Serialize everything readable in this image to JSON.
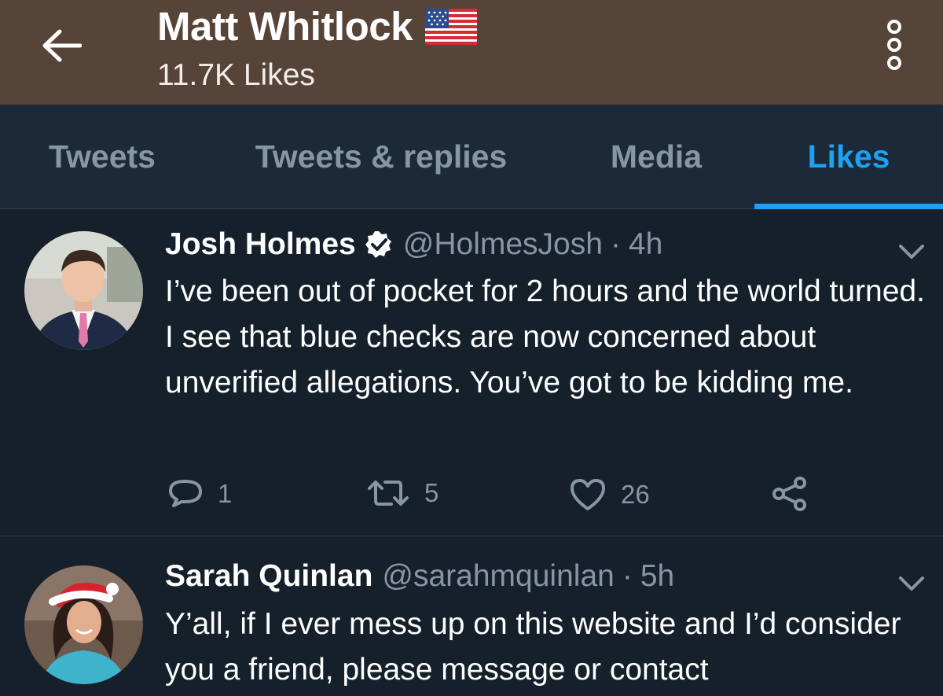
{
  "header": {
    "title": "Matt Whitlock",
    "subtitle": "11.7K Likes",
    "flag_icon": "us-flag-icon",
    "back_icon": "arrow-left-icon",
    "more_icon": "more-vertical-icon"
  },
  "tabs": [
    {
      "label": "Tweets",
      "active": false
    },
    {
      "label": "Tweets & replies",
      "active": false
    },
    {
      "label": "Media",
      "active": false
    },
    {
      "label": "Likes",
      "active": true
    }
  ],
  "tweets": [
    {
      "name": "Josh Holmes",
      "verified": true,
      "handle": "@HolmesJosh",
      "separator": "·",
      "time": "4h",
      "text": "I’ve been out of pocket for 2 hours and the world turned. I see that blue checks are now concerned about unverified allegations. You’ve got to be kidding me.",
      "replies": "1",
      "retweets": "5",
      "likes": "26"
    },
    {
      "name": "Sarah Quinlan",
      "verified": false,
      "handle": "@sarahmquinlan",
      "separator": "·",
      "time": "5h",
      "text": "Y’all, if I ever mess up on this website and I’d consider you a friend, please message or contact"
    }
  ],
  "colors": {
    "header_bg": "#574439",
    "tabs_bg": "#1c2938",
    "page_bg": "#15202b",
    "accent": "#1da1f2",
    "muted": "#8796a5"
  }
}
